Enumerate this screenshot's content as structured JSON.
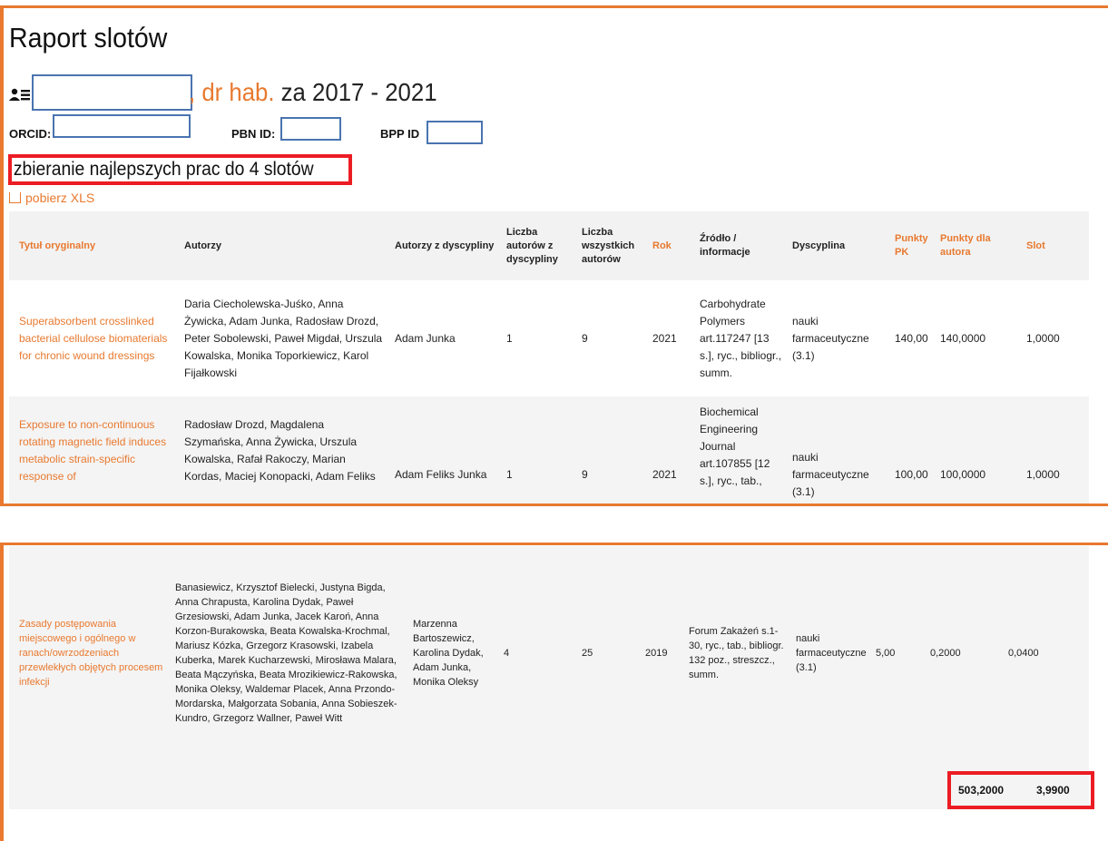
{
  "page": {
    "title": "Raport slotów",
    "degree": ", dr hab.",
    "period": " za 2017 - 2021",
    "orcid_label": "ORCID:",
    "pbn_label": "PBN ID:",
    "bpp_label": "BPP ID",
    "strategy": "zbieranie najlepszych prac do 4 slotów",
    "download_label": "pobierz XLS"
  },
  "colors": {
    "accent": "#e8792f",
    "highlight": "#ec1c24",
    "redaction_border": "#4a74b0"
  },
  "icons": {
    "user": "user-card-icon",
    "download": "download-icon"
  },
  "table": {
    "headers": [
      "Tytuł oryginalny",
      "Autorzy",
      "Autorzy z dyscypliny",
      "Liczba autorów z dyscypliny",
      "Liczba wszystkich autorów",
      "Rok",
      "Źródło / informacje",
      "Dyscyplina",
      "Punkty PK",
      "Punkty dla autora",
      "Slot"
    ],
    "rows": [
      {
        "title": "Superabsorbent crosslinked bacterial cellulose biomaterials for chronic wound dressings",
        "authors": "Daria Ciecholewska-Juśko, Anna Żywicka, Adam Junka, Radosław Drozd, Peter Sobolewski, Paweł Migdał, Urszula Kowalska, Monika Toporkiewicz, Karol Fijałkowski",
        "discipline_authors": "Adam Junka",
        "n_discipline_authors": "1",
        "n_all_authors": "9",
        "year": "2021",
        "source": "Carbohydrate Polymers art.117247 [13 s.], ryc., bibliogr., summ.",
        "discipline": "nauki farmaceutyczne (3.1)",
        "points_pk": "140,00",
        "points_author": "140,0000",
        "slot": "1,0000"
      },
      {
        "title": "Exposure to non-continuous rotating magnetic field induces metabolic strain-specific response of",
        "authors": "Radosław Drozd, Magdalena Szymańska, Anna Żywicka, Urszula Kowalska, Rafał Rakoczy, Marian Kordas, Maciej Konopacki, Adam Feliks",
        "discipline_authors": "Adam Feliks Junka",
        "n_discipline_authors": "1",
        "n_all_authors": "9",
        "year": "2021",
        "source": "Biochemical Engineering Journal art.107855 [12 s.], ryc., tab.,",
        "discipline": "nauki farmaceutyczne (3.1)",
        "points_pk": "100,00",
        "points_author": "100,0000",
        "slot": "1,0000"
      },
      {
        "title": "Zasady postępowania miejscowego i ogólnego w ranach/owrzodzeniach przewlekłych objętych procesem infekcji",
        "authors": "Banasiewicz, Krzysztof Bielecki, Justyna Bigda, Anna Chrapusta, Karolina Dydak, Paweł Grzesiowski, Adam Junka, Jacek Karoń, Anna Korzon-Burakowska, Beata Kowalska-Krochmal, Mariusz Kózka, Grzegorz Krasowski, Izabela Kuberka, Marek Kucharzewski, Mirosława Malara, Beata Mączyńska, Beata Mrozikiewicz-Rakowska, Monika Oleksy, Waldemar Placek, Anna Przondo-Mordarska, Małgorzata Sobania, Anna Sobieszek-Kundro, Grzegorz Wallner, Paweł Witt",
        "discipline_authors": "Marzenna Bartoszewicz, Karolina Dydak, Adam Junka, Monika Oleksy",
        "n_discipline_authors": "4",
        "n_all_authors": "25",
        "year": "2019",
        "source": "Forum Zakażeń s.1-30, ryc., tab., bibliogr. 132 poz., streszcz., summ.",
        "discipline": "nauki farmaceutyczne (3.1)",
        "points_pk": "5,00",
        "points_author": "0,2000",
        "slot": "0,0400"
      }
    ],
    "totals": {
      "points_author": "503,2000",
      "slot": "3,9900"
    }
  }
}
